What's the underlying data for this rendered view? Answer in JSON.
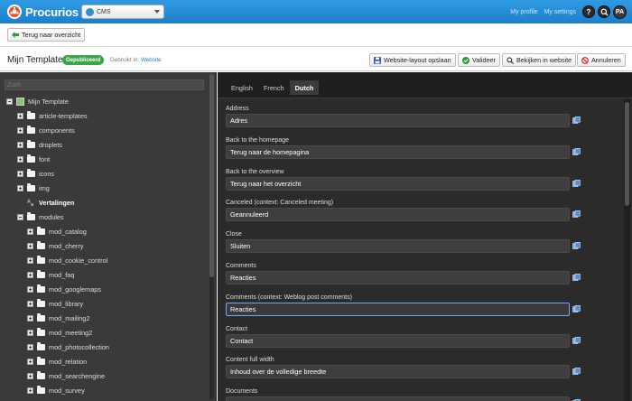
{
  "header": {
    "logo_text": "Procurios",
    "app_select": "CMS",
    "links": [
      "My profile",
      "My settings"
    ],
    "help_label": "?",
    "avatar_initials": "PA"
  },
  "toolbar": {
    "back_label": "Terug naar overzicht"
  },
  "title_bar": {
    "title": "Mijn Template",
    "status_badge": "Gepubliceerd",
    "used_in_label": "Gebruikt in:",
    "used_in_link": "Website",
    "actions": {
      "save": "Website-layout opslaan",
      "validate": "Valideer",
      "view": "Bekijken in website",
      "cancel": "Annuleren"
    }
  },
  "sidebar": {
    "search_placeholder": "Zoek",
    "tree": [
      {
        "label": "Mijn Template",
        "type": "root",
        "level": 0,
        "expander": "minus"
      },
      {
        "label": "article-templates",
        "type": "folder",
        "level": 1,
        "expander": "plus"
      },
      {
        "label": "components",
        "type": "folder",
        "level": 1,
        "expander": "plus"
      },
      {
        "label": "droplets",
        "type": "folder",
        "level": 1,
        "expander": "plus"
      },
      {
        "label": "font",
        "type": "folder",
        "level": 1,
        "expander": "plus"
      },
      {
        "label": "icons",
        "type": "folder",
        "level": 1,
        "expander": "plus"
      },
      {
        "label": "img",
        "type": "folder",
        "level": 1,
        "expander": "plus"
      },
      {
        "label": "Vertalingen",
        "type": "translations",
        "level": 1,
        "expander": "none"
      },
      {
        "label": "modules",
        "type": "folder",
        "level": 1,
        "expander": "minus"
      },
      {
        "label": "mod_catalog",
        "type": "folder",
        "level": 2,
        "expander": "plus"
      },
      {
        "label": "mod_cherry",
        "type": "folder",
        "level": 2,
        "expander": "plus"
      },
      {
        "label": "mod_cookie_control",
        "type": "folder",
        "level": 2,
        "expander": "plus"
      },
      {
        "label": "mod_faq",
        "type": "folder",
        "level": 2,
        "expander": "plus"
      },
      {
        "label": "mod_googlemaps",
        "type": "folder",
        "level": 2,
        "expander": "plus"
      },
      {
        "label": "mod_library",
        "type": "folder",
        "level": 2,
        "expander": "plus"
      },
      {
        "label": "mod_mailing2",
        "type": "folder",
        "level": 2,
        "expander": "plus"
      },
      {
        "label": "mod_meeting2",
        "type": "folder",
        "level": 2,
        "expander": "plus"
      },
      {
        "label": "mod_photocollection",
        "type": "folder",
        "level": 2,
        "expander": "plus"
      },
      {
        "label": "mod_relation",
        "type": "folder",
        "level": 2,
        "expander": "plus"
      },
      {
        "label": "mod_searchengine",
        "type": "folder",
        "level": 2,
        "expander": "plus"
      },
      {
        "label": "mod_survey",
        "type": "folder",
        "level": 2,
        "expander": "plus"
      }
    ]
  },
  "language_tabs": [
    "English",
    "French",
    "Dutch"
  ],
  "active_tab": "Dutch",
  "translations": [
    {
      "label": "Address",
      "value": "Adres"
    },
    {
      "label": "Back to the homepage",
      "value": "Terug naar de homepagina"
    },
    {
      "label": "Back to the overview",
      "value": "Terug naar het overzicht"
    },
    {
      "label": "Canceled (context: Canceled meeting)",
      "value": "Geannuleerd"
    },
    {
      "label": "Close",
      "value": "Sluiten"
    },
    {
      "label": "Comments",
      "value": "Reacties"
    },
    {
      "label": "Comments (context: Weblog post comments)",
      "value": "Reacties",
      "focused": true
    },
    {
      "label": "Contact",
      "value": "Contact"
    },
    {
      "label": "Content full width",
      "value": "Inhoud over de volledige breedte"
    },
    {
      "label": "Documents",
      "value": ""
    }
  ],
  "colors": {
    "header_blue": "#1c7fc9",
    "published_green": "#3aa64a",
    "panel_dark": "#2b2b2b",
    "focus_blue": "#6fa8ff"
  }
}
